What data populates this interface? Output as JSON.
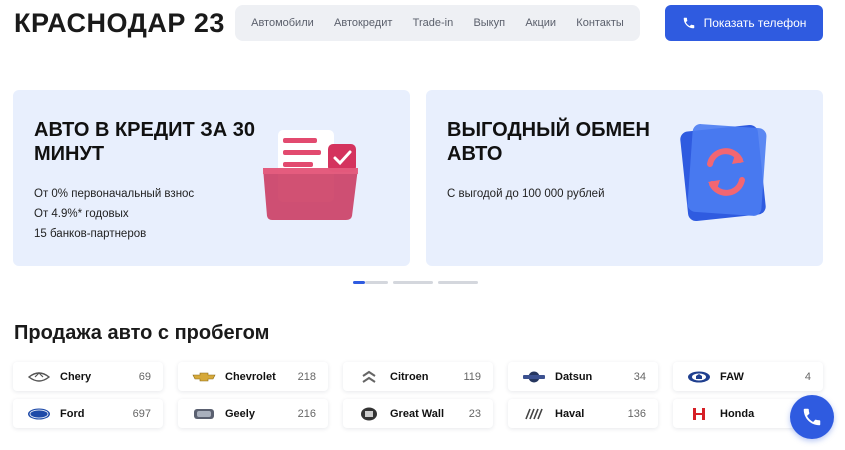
{
  "header": {
    "logo": "КРАСНОДАР 23",
    "nav": [
      "Автомобили",
      "Автокредит",
      "Trade-in",
      "Выкуп",
      "Акции",
      "Контакты"
    ],
    "phone_label": "Показать телефон"
  },
  "banners": [
    {
      "title": "АВТО В КРЕДИТ ЗА 30 МИНУТ",
      "lines": [
        "От 0% первоначальный взнос",
        "От 4.9%* годовых",
        "15 банков-партнеров"
      ]
    },
    {
      "title": "ВЫГОДНЫЙ ОБМЕН АВТО",
      "lines": [
        "С выгодой до 100 000 рублей"
      ]
    }
  ],
  "carousel": {
    "slides": 3,
    "active": 0
  },
  "section_title": "Продажа авто с пробегом",
  "brands": [
    {
      "name": "Chery",
      "count": "69",
      "icon": "chery-logo-icon"
    },
    {
      "name": "Chevrolet",
      "count": "218",
      "icon": "chevrolet-logo-icon"
    },
    {
      "name": "Citroen",
      "count": "119",
      "icon": "citroen-logo-icon"
    },
    {
      "name": "Datsun",
      "count": "34",
      "icon": "datsun-logo-icon"
    },
    {
      "name": "FAW",
      "count": "4",
      "icon": "faw-logo-icon"
    },
    {
      "name": "Ford",
      "count": "697",
      "icon": "ford-logo-icon"
    },
    {
      "name": "Geely",
      "count": "216",
      "icon": "geely-logo-icon"
    },
    {
      "name": "Great Wall",
      "count": "23",
      "icon": "great-wall-logo-icon"
    },
    {
      "name": "Haval",
      "count": "136",
      "icon": "haval-logo-icon"
    },
    {
      "name": "Honda",
      "count": "",
      "icon": "honda-logo-icon"
    }
  ],
  "colors": {
    "accent": "#2f5be0",
    "banner_bg": "#e8effd",
    "nav_bg": "#eef0f4"
  }
}
